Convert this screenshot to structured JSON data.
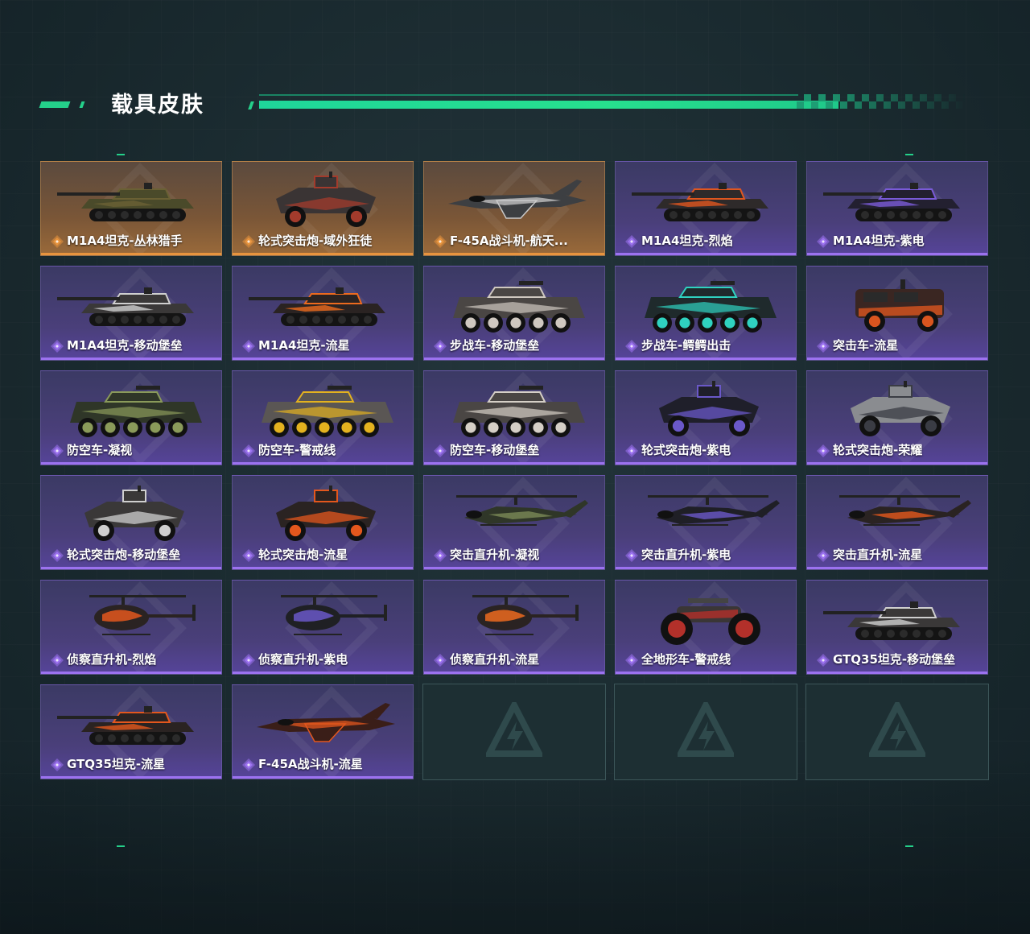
{
  "page": {
    "title": "载具皮肤"
  },
  "colors": {
    "accent": "#24d08a",
    "rare_purple": "#9c72f0",
    "rare_gold": "#e8943e"
  },
  "skins": [
    {
      "name": "M1A4坦克-丛林猎手",
      "rarity": "gold",
      "kind": "tank",
      "paint": "#4a4a2a",
      "trim": "#6a6034"
    },
    {
      "name": "轮式突击炮-域外狂徒",
      "rarity": "gold",
      "kind": "wheeled",
      "paint": "#3a3434",
      "trim": "#a33b2c"
    },
    {
      "name": "F-45A战斗机-航天...",
      "rarity": "gold",
      "kind": "jet",
      "paint": "#3d3f42",
      "trim": "#c9c9c9"
    },
    {
      "name": "M1A4坦克-烈焰",
      "rarity": "purple",
      "kind": "tank",
      "paint": "#2e2a2a",
      "trim": "#e0561f"
    },
    {
      "name": "M1A4坦克-紫电",
      "rarity": "purple",
      "kind": "tank",
      "paint": "#232030",
      "trim": "#7a5bd8"
    },
    {
      "name": "M1A4坦克-移动堡垒",
      "rarity": "purple",
      "kind": "tank",
      "paint": "#3a3838",
      "trim": "#cfcfcf"
    },
    {
      "name": "M1A4坦克-流星",
      "rarity": "purple",
      "kind": "tank",
      "paint": "#2a2322",
      "trim": "#ec6a1e"
    },
    {
      "name": "步战车-移动堡垒",
      "rarity": "purple",
      "kind": "apc",
      "paint": "#4a4644",
      "trim": "#cfc8c0"
    },
    {
      "name": "步战车-鳄鳄出击",
      "rarity": "purple",
      "kind": "apc",
      "paint": "#1f2a2c",
      "trim": "#2fd2c0"
    },
    {
      "name": "突击车-流星",
      "rarity": "purple",
      "kind": "truck",
      "paint": "#3a2622",
      "trim": "#d9551f"
    },
    {
      "name": "防空车-凝视",
      "rarity": "purple",
      "kind": "apc",
      "paint": "#2f3628",
      "trim": "#8a9a5a"
    },
    {
      "name": "防空车-警戒线",
      "rarity": "purple",
      "kind": "apc",
      "paint": "#5a5654",
      "trim": "#e3b21f"
    },
    {
      "name": "防空车-移动堡垒",
      "rarity": "purple",
      "kind": "apc",
      "paint": "#4a4644",
      "trim": "#d5cfc6"
    },
    {
      "name": "轮式突击炮-紫电",
      "rarity": "purple",
      "kind": "wheeled",
      "paint": "#1f1f2a",
      "trim": "#6a58c8"
    },
    {
      "name": "轮式突击炮-荣耀",
      "rarity": "purple",
      "kind": "wheeled",
      "paint": "#8a8c90",
      "trim": "#3a3c44"
    },
    {
      "name": "轮式突击炮-移动堡垒",
      "rarity": "purple",
      "kind": "wheeled",
      "paint": "#3a3838",
      "trim": "#cfcfcf"
    },
    {
      "name": "轮式突击炮-流星",
      "rarity": "purple",
      "kind": "wheeled",
      "paint": "#2a2322",
      "trim": "#e3571d"
    },
    {
      "name": "突击直升机-凝视",
      "rarity": "purple",
      "kind": "heli",
      "paint": "#2f3628",
      "trim": "#7a8a56"
    },
    {
      "name": "突击直升机-紫电",
      "rarity": "purple",
      "kind": "heli",
      "paint": "#1f1f26",
      "trim": "#6a58c8"
    },
    {
      "name": "突击直升机-流星",
      "rarity": "purple",
      "kind": "heli",
      "paint": "#2a2322",
      "trim": "#e3571d"
    },
    {
      "name": "侦察直升机-烈焰",
      "rarity": "purple",
      "kind": "smallheli",
      "paint": "#2a2322",
      "trim": "#e3571d"
    },
    {
      "name": "侦察直升机-紫电",
      "rarity": "purple",
      "kind": "smallheli",
      "paint": "#1f2024",
      "trim": "#6a58c8"
    },
    {
      "name": "侦察直升机-流星",
      "rarity": "purple",
      "kind": "smallheli",
      "paint": "#2a2322",
      "trim": "#ec6a1e"
    },
    {
      "name": "全地形车-警戒线",
      "rarity": "purple",
      "kind": "atv",
      "paint": "#3a3636",
      "trim": "#b3302a"
    },
    {
      "name": "GTQ35坦克-移动堡垒",
      "rarity": "purple",
      "kind": "tank",
      "paint": "#3a3838",
      "trim": "#cfcfcf"
    },
    {
      "name": "GTQ35坦克-流星",
      "rarity": "purple",
      "kind": "tank",
      "paint": "#2a2322",
      "trim": "#e3571d"
    },
    {
      "name": "F-45A战斗机-流星",
      "rarity": "purple",
      "kind": "jet",
      "paint": "#3a1e18",
      "trim": "#e3571d"
    }
  ],
  "empty_slots": 3
}
